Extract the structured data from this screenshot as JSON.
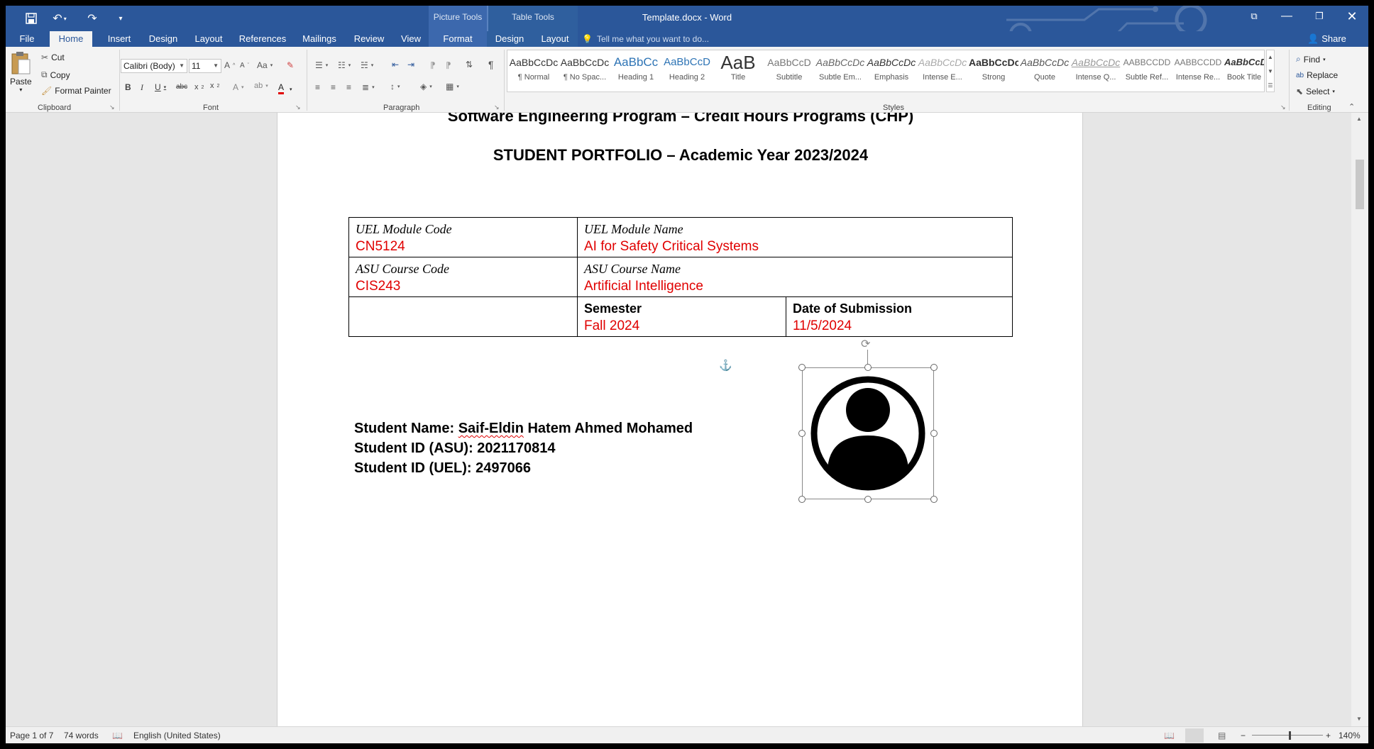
{
  "titlebar": {
    "document_title": "Template.docx - Word",
    "context_picture": "Picture Tools",
    "context_table": "Table Tools"
  },
  "tabs": [
    {
      "label": "File"
    },
    {
      "label": "Home"
    },
    {
      "label": "Insert"
    },
    {
      "label": "Design"
    },
    {
      "label": "Layout"
    },
    {
      "label": "References"
    },
    {
      "label": "Mailings"
    },
    {
      "label": "Review"
    },
    {
      "label": "View"
    },
    {
      "label": "Format"
    },
    {
      "label": "Design"
    },
    {
      "label": "Layout"
    }
  ],
  "tell_me": "Tell me what you want to do...",
  "share": "Share",
  "clipboard": {
    "paste": "Paste",
    "cut": "Cut",
    "copy": "Copy",
    "format_painter": "Format Painter",
    "group": "Clipboard"
  },
  "font": {
    "name": "Calibri (Body)",
    "size": "11",
    "group": "Font"
  },
  "paragraph": {
    "group": "Paragraph"
  },
  "styles": {
    "group": "Styles",
    "items": [
      {
        "preview": "AaBbCcDc",
        "name": "¶ Normal"
      },
      {
        "preview": "AaBbCcDc",
        "name": "¶ No Spac..."
      },
      {
        "preview": "AaBbCc",
        "name": "Heading 1"
      },
      {
        "preview": "AaBbCcD",
        "name": "Heading 2"
      },
      {
        "preview": "AaB",
        "name": "Title"
      },
      {
        "preview": "AaBbCcD",
        "name": "Subtitle"
      },
      {
        "preview": "AaBbCcDc",
        "name": "Subtle Em..."
      },
      {
        "preview": "AaBbCcDc",
        "name": "Emphasis"
      },
      {
        "preview": "AaBbCcDc",
        "name": "Intense E..."
      },
      {
        "preview": "AaBbCcDc",
        "name": "Strong"
      },
      {
        "preview": "AaBbCcDc",
        "name": "Quote"
      },
      {
        "preview": "AaBbCcDc",
        "name": "Intense Q..."
      },
      {
        "preview": "AABBCCDD",
        "name": "Subtle Ref..."
      },
      {
        "preview": "AABBCCDD",
        "name": "Intense Re..."
      },
      {
        "preview": "AaBbCcDc",
        "name": "Book Title"
      }
    ]
  },
  "editing": {
    "find": "Find",
    "replace": "Replace",
    "select": "Select",
    "group": "Editing"
  },
  "document": {
    "heading1": "Software Engineering Program – Credit Hours Programs (CHP)",
    "heading2": "STUDENT PORTFOLIO – Academic Year 2023/2024",
    "table": {
      "uel_code_label": "UEL Module Code",
      "uel_code_value": "CN5124",
      "uel_name_label": "UEL Module Name",
      "uel_name_value": "AI for Safety Critical Systems",
      "asu_code_label": "ASU Course Code",
      "asu_code_value": "CIS243",
      "asu_name_label": "ASU Course Name",
      "asu_name_value": "Artificial Intelligence",
      "semester_label": "Semester",
      "semester_value": "Fall 2024",
      "date_label": "Date of Submission",
      "date_value": "11/5/2024"
    },
    "student": {
      "name_label": "Student Name:",
      "name_first": "Saif-Eldin",
      "name_rest": "Hatem Ahmed Mohamed",
      "asu_line": "Student ID (ASU): 2021170814",
      "uel_line": "Student ID (UEL): 2497066"
    }
  },
  "statusbar": {
    "page": "Page 1 of 7",
    "words": "74 words",
    "language": "English (United States)",
    "zoom": "140%"
  },
  "colors": {
    "word_blue": "#2b579a",
    "value_red": "#e00000"
  }
}
